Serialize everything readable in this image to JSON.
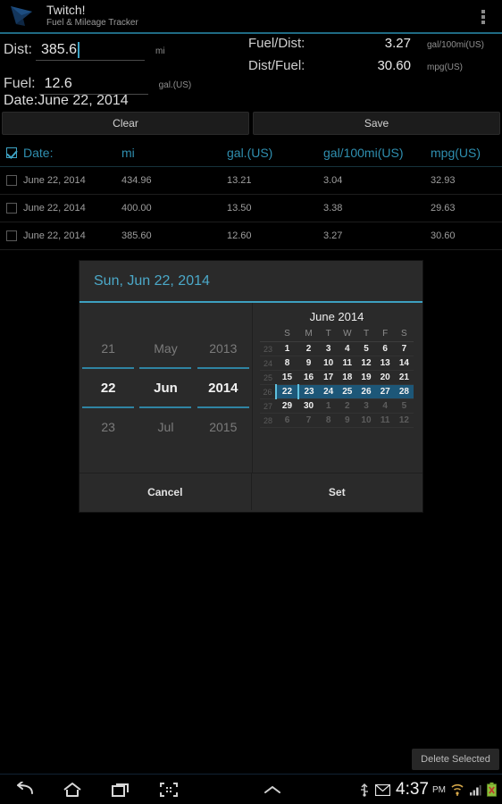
{
  "app": {
    "title": "Twitch!",
    "subtitle": "Fuel & Mileage Tracker",
    "logo_icon": "fuel-nozzle-icon",
    "overflow_icon": "overflow-menu-icon"
  },
  "form": {
    "dist": {
      "label": "Dist:",
      "value": "385.6",
      "unit": "mi"
    },
    "fuel": {
      "label": "Fuel:",
      "value": "12.6",
      "unit": "gal.(US)"
    },
    "date": {
      "label": "Date:",
      "value": "June 22, 2014"
    }
  },
  "stats": [
    {
      "name": "Fuel/Dist:",
      "value": "3.27",
      "unit": "gal/100mi(US)"
    },
    {
      "name": "Dist/Fuel:",
      "value": "30.60",
      "unit": "mpg(US)"
    }
  ],
  "buttons": {
    "clear": "Clear",
    "save": "Save",
    "delete_selected": "Delete Selected"
  },
  "table": {
    "headers": [
      "Date:",
      "mi",
      "gal.(US)",
      "gal/100mi(US)",
      "mpg(US)"
    ],
    "header_checked": true,
    "rows": [
      {
        "checked": false,
        "date": "June 22, 2014",
        "mi": "434.96",
        "gal": "13.21",
        "gpm": "3.04",
        "mpg": "32.93"
      },
      {
        "checked": false,
        "date": "June 22, 2014",
        "mi": "400.00",
        "gal": "13.50",
        "gpm": "3.38",
        "mpg": "29.63"
      },
      {
        "checked": false,
        "date": "June 22, 2014",
        "mi": "385.60",
        "gal": "12.60",
        "gpm": "3.27",
        "mpg": "30.60"
      }
    ]
  },
  "datepicker": {
    "header": "Sun, Jun 22, 2014",
    "day": {
      "prev": "21",
      "current": "22",
      "next": "23"
    },
    "month": {
      "prev": "May",
      "current": "Jun",
      "next": "Jul"
    },
    "year": {
      "prev": "2013",
      "current": "2014",
      "next": "2015"
    },
    "calendar": {
      "title": "June 2014",
      "weekday_headers": [
        "S",
        "M",
        "T",
        "W",
        "T",
        "F",
        "S"
      ],
      "week_numbers": [
        "23",
        "24",
        "25",
        "26",
        "27",
        "28"
      ],
      "weeks": [
        {
          "days": [
            "1",
            "2",
            "3",
            "4",
            "5",
            "6",
            "7"
          ],
          "other": [
            false,
            false,
            false,
            false,
            false,
            false,
            false
          ],
          "selected": false
        },
        {
          "days": [
            "8",
            "9",
            "10",
            "11",
            "12",
            "13",
            "14"
          ],
          "other": [
            false,
            false,
            false,
            false,
            false,
            false,
            false
          ],
          "selected": false
        },
        {
          "days": [
            "15",
            "16",
            "17",
            "18",
            "19",
            "20",
            "21"
          ],
          "other": [
            false,
            false,
            false,
            false,
            false,
            false,
            false
          ],
          "selected": false
        },
        {
          "days": [
            "22",
            "23",
            "24",
            "25",
            "26",
            "27",
            "28"
          ],
          "other": [
            false,
            false,
            false,
            false,
            false,
            false,
            false
          ],
          "selected": true,
          "today_index": 0
        },
        {
          "days": [
            "29",
            "30",
            "1",
            "2",
            "3",
            "4",
            "5"
          ],
          "other": [
            false,
            false,
            true,
            true,
            true,
            true,
            true
          ],
          "selected": false
        },
        {
          "days": [
            "6",
            "7",
            "8",
            "9",
            "10",
            "11",
            "12"
          ],
          "other": [
            true,
            true,
            true,
            true,
            true,
            true,
            true
          ],
          "selected": false
        }
      ]
    },
    "cancel": "Cancel",
    "set": "Set"
  },
  "navbar": {
    "back_icon": "back-arrow-icon",
    "home_icon": "home-icon",
    "recents_icon": "recent-apps-icon",
    "screenshot_icon": "screenshot-capture-icon",
    "expand_icon": "chevron-up-icon",
    "usb_icon": "usb-icon",
    "mail_icon": "mail-icon",
    "time": "4:37",
    "ampm": "PM",
    "wifi_icon": "wifi-icon",
    "signal_icon": "signal-bars-icon",
    "battery_icon": "battery-error-icon"
  },
  "colors": {
    "accent": "#3ea3c4",
    "header_text": "#2f8fb0",
    "selected_week": "#1d5778"
  }
}
